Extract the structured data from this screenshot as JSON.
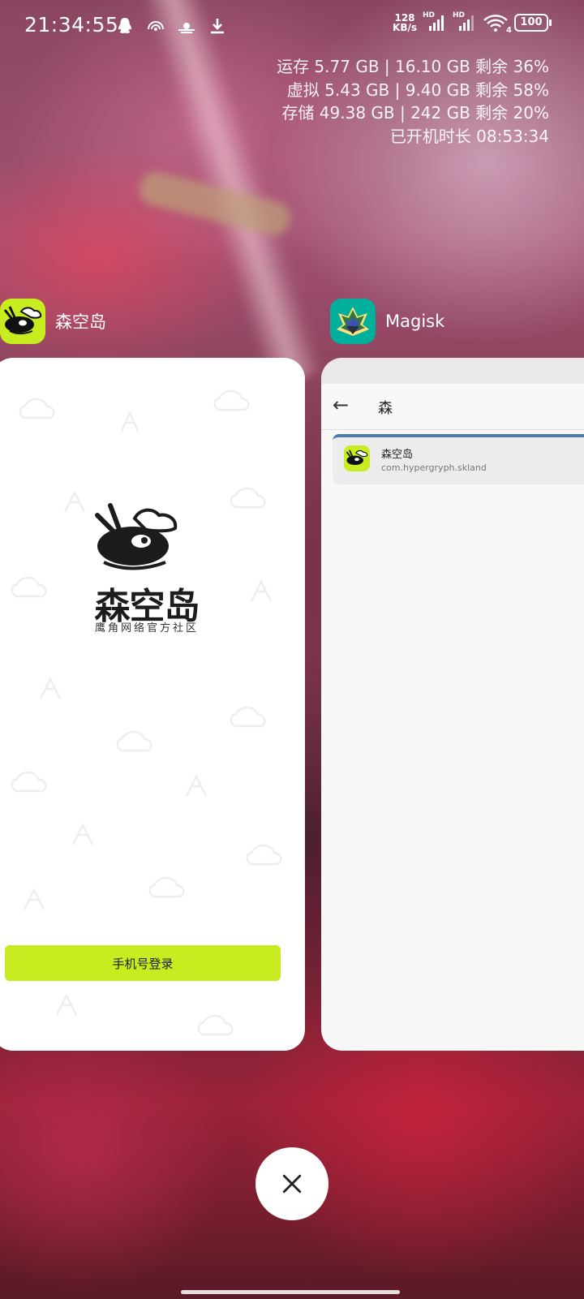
{
  "status_bar": {
    "time": "21:34:55",
    "net_speed_value": "128",
    "net_speed_unit": "KB/s",
    "sim1_label": "HD",
    "sim2_label": "HD",
    "wifi_badge": "4",
    "battery": "100",
    "icons": [
      "qq-icon",
      "hotspot-icon",
      "weather-icon",
      "download-icon"
    ]
  },
  "memory_info": {
    "ram": "运存 5.77 GB | 16.10 GB 剩余 36%",
    "virtual": "虚拟 5.43 GB | 9.40 GB 剩余 58%",
    "storage": "存储 49.38 GB | 242 GB 剩余 20%",
    "uptime": "已开机时长 08:53:34"
  },
  "recent_apps": [
    {
      "name": "森空岛",
      "content": {
        "logo_title": "森空岛",
        "logo_subtitle": "鹰角网络官方社区",
        "login_button": "手机号登录"
      }
    },
    {
      "name": "Magisk",
      "content": {
        "search_query": "森",
        "result_name": "森空岛",
        "result_package": "com.hypergryph.skland"
      }
    }
  ],
  "colors": {
    "skland_accent": "#c7ec1f",
    "magisk_icon_bg": "#00af9c",
    "magisk_row_highlight": "#4a7dab"
  }
}
